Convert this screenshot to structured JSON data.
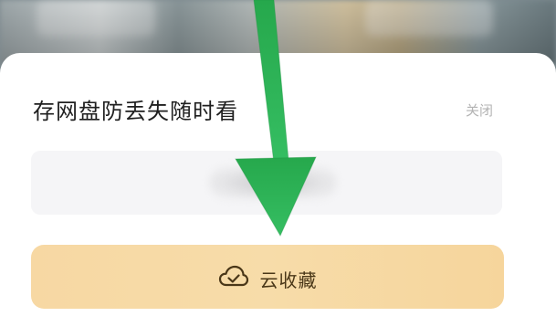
{
  "dialog": {
    "title": "存网盘防丢失随时看",
    "close_label": "关闭",
    "primary_button_label": "云收藏",
    "primary_button_icon": "cloud-check-icon"
  },
  "overlay": {
    "annotation": "arrow-pointing-to-button",
    "arrow_color": "#2fb45a"
  },
  "colors": {
    "button_bg": "#f7d8a3",
    "button_text": "#4a3718",
    "title_text": "#1f1f1f",
    "close_text": "#b3b3b3"
  }
}
